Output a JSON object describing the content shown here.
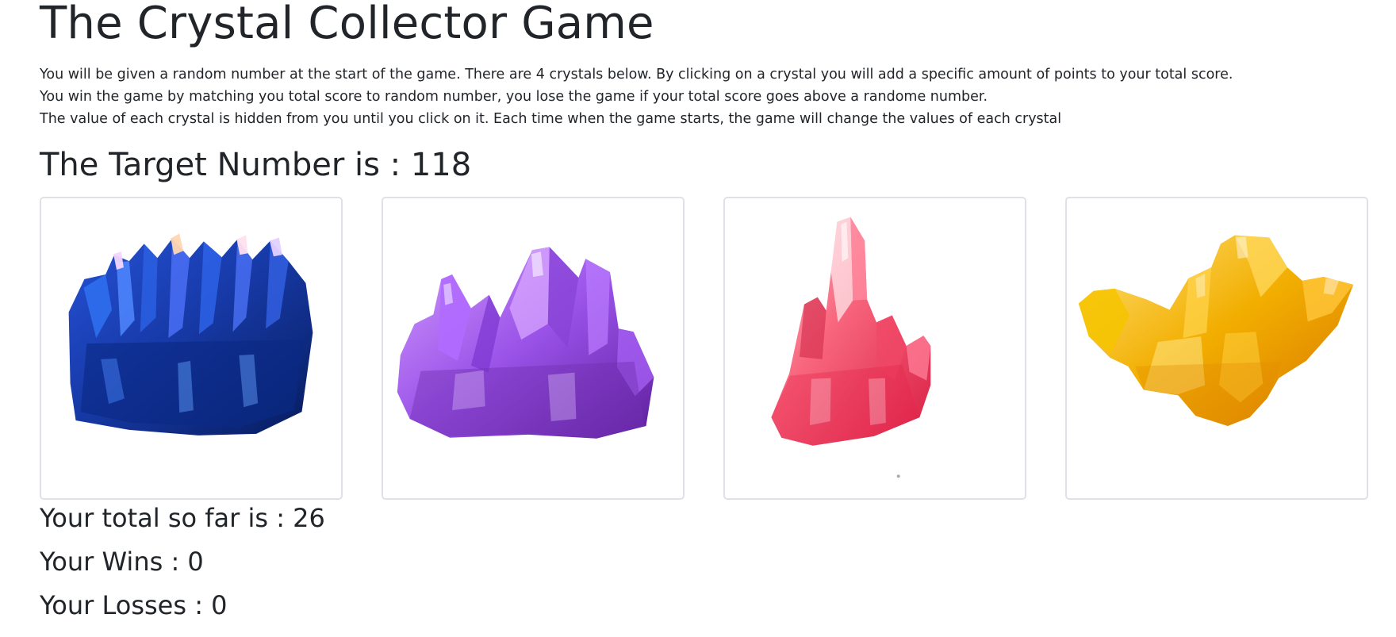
{
  "game": {
    "title": "The Crystal Collector Game",
    "instructions": [
      "You will be given a random number at the start of the game. There are 4 crystals below. By clicking on a crystal you will add a specific amount of points to your total score.",
      "You win the game by matching you total score to random number, you lose the game if your total score goes above a randome number.",
      "The value of each crystal is hidden from you until you click on it. Each time when the game starts, the game will change the values of each crystal"
    ],
    "target_text": "The Target Number is : 118",
    "crystals": [
      {
        "icon": "blue-crystal-icon",
        "color": "#1d3d9a"
      },
      {
        "icon": "purple-crystal-icon",
        "color": "#8e4ad8"
      },
      {
        "icon": "pink-crystal-icon",
        "color": "#f0516f"
      },
      {
        "icon": "yellow-crystal-icon",
        "color": "#f2b300"
      }
    ],
    "stats": {
      "total_text": "Your total so far is : 26",
      "wins_text": "Your Wins : 0",
      "losses_text": "Your Losses : 0"
    }
  }
}
